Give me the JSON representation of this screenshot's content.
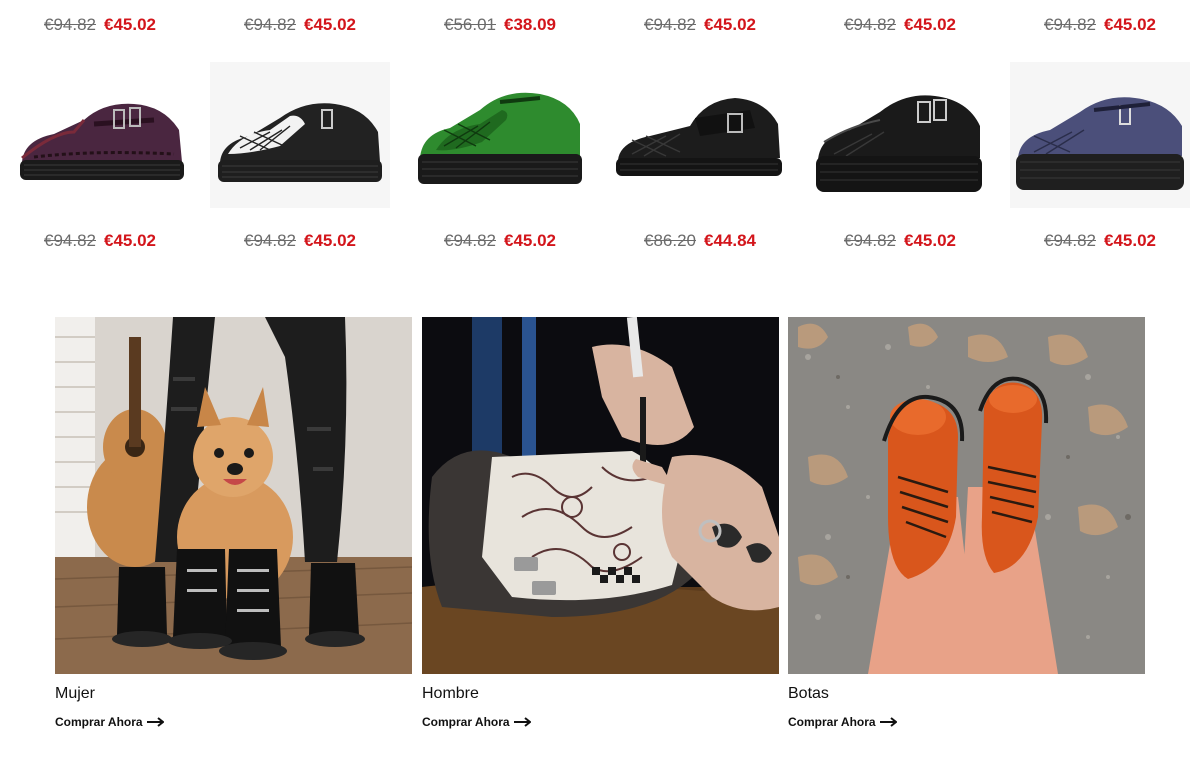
{
  "top_prices": [
    {
      "old": "€94.82",
      "new": "€45.02"
    },
    {
      "old": "€94.82",
      "new": "€45.02"
    },
    {
      "old": "€56.01",
      "new": "€38.09"
    },
    {
      "old": "€94.82",
      "new": "€45.02"
    },
    {
      "old": "€94.82",
      "new": "€45.02"
    },
    {
      "old": "€94.82",
      "new": "€45.02"
    }
  ],
  "products": [
    {
      "image": "purple-leather-creeper",
      "color": "#4a2640",
      "old": "€94.82",
      "new": "€45.02"
    },
    {
      "image": "black-white-creeper",
      "color": "#222222",
      "old": "€94.82",
      "new": "€45.02"
    },
    {
      "image": "green-suede-creeper",
      "color": "#2e8b2e",
      "old": "€94.82",
      "new": "€45.02"
    },
    {
      "image": "black-mary-jane-creeper",
      "color": "#1c1c1c",
      "old": "€86.20",
      "new": "€44.84"
    },
    {
      "image": "black-leather-creeper",
      "color": "#1a1a1a",
      "old": "€94.82",
      "new": "€45.02"
    },
    {
      "image": "navy-suede-creeper",
      "color": "#4b4f7a",
      "old": "€94.82",
      "new": "€45.02"
    }
  ],
  "categories": [
    {
      "title": "Mujer",
      "cta": "Comprar Ahora",
      "image": "woman-with-dog-boots"
    },
    {
      "title": "Hombre",
      "cta": "Comprar Ahora",
      "image": "hand-drawing-on-sneaker"
    },
    {
      "title": "Botas",
      "cta": "Comprar Ahora",
      "image": "orange-boots-on-gravel"
    }
  ],
  "colors": {
    "sale_price": "#d3151b",
    "old_price": "#6b6b6b"
  }
}
